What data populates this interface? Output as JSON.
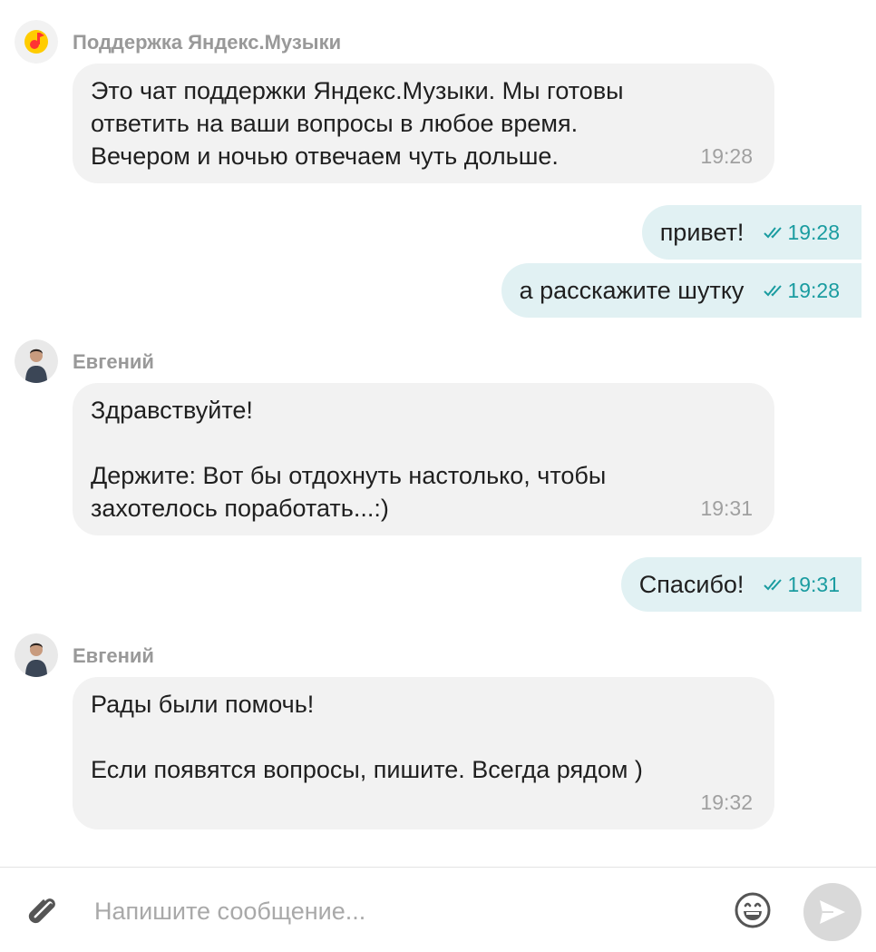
{
  "chat": {
    "support_name": "Поддержка Яндекс.Музыки",
    "messages": [
      {
        "direction": "in",
        "text": "Это чат поддержки Яндекс.Музыки. Мы готовы\nответить на ваши вопросы в любое время.\nВечером и ночью отвечаем чуть дольше.",
        "time": "19:28"
      },
      {
        "direction": "out",
        "text": "привет!",
        "time": "19:28",
        "status": "read"
      },
      {
        "direction": "out",
        "text": "а расскажите шутку",
        "time": "19:28",
        "status": "read"
      },
      {
        "direction": "in",
        "sender": "Евгений",
        "text": "Здравствуйте!\n\nДержите: Вот бы отдохнуть настолько, чтобы\nзахотелось поработать...:)",
        "time": "19:31"
      },
      {
        "direction": "out",
        "text": "Спасибо!",
        "time": "19:31",
        "status": "read"
      },
      {
        "direction": "in",
        "sender": "Евгений",
        "text": "Рады были помочь!\n\nЕсли появятся вопросы, пишите. Всегда рядом )",
        "time": "19:32"
      }
    ]
  },
  "composer": {
    "placeholder": "Напишите сообщение...",
    "value": ""
  },
  "colors": {
    "incoming_bubble": "#f2f2f2",
    "outgoing_bubble": "#e1f1f3",
    "read_status": "#1a9ca0",
    "brand_yellow": "#ffcc00",
    "brand_red": "#ff3333",
    "send_button": "#d9d9d9"
  },
  "icons": {
    "support_avatar": "yandex-music-logo",
    "agent_avatar": "agent-photo",
    "read_receipt": "double-check-icon",
    "attach": "paperclip-icon",
    "emoji": "smiley-icon",
    "send": "send-arrow-icon"
  }
}
